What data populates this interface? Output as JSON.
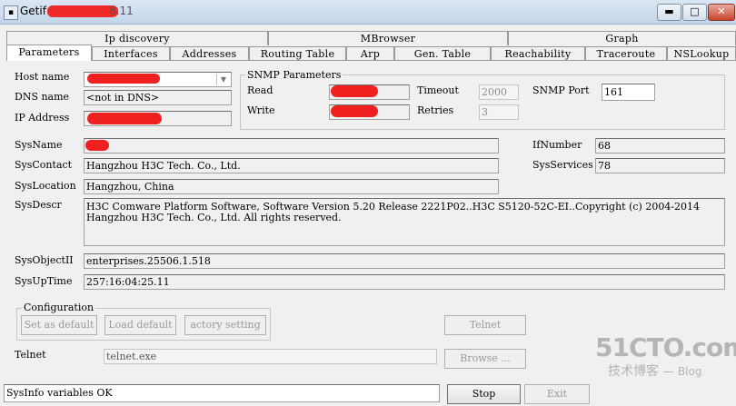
{
  "window": {
    "title": "Getif",
    "title_suffix": "8.11",
    "buttons": {
      "minimize": "▬",
      "maximize": "□",
      "close": "✕"
    }
  },
  "tabs_row1": [
    {
      "label": "Ip discovery"
    },
    {
      "label": "MBrowser"
    },
    {
      "label": "Graph"
    }
  ],
  "tabs_row2": [
    {
      "label": "Parameters"
    },
    {
      "label": "Interfaces"
    },
    {
      "label": "Addresses"
    },
    {
      "label": "Routing Table"
    },
    {
      "label": "Arp"
    },
    {
      "label": "Gen. Table"
    },
    {
      "label": "Reachability"
    },
    {
      "label": "Traceroute"
    },
    {
      "label": "NSLookup"
    }
  ],
  "host": {
    "host_name_label": "Host name",
    "dns_name_label": "DNS name",
    "dns_name_value": "<not in DNS>",
    "ip_address_label": "IP Address"
  },
  "snmp": {
    "group_label": "SNMP Parameters",
    "read_label": "Read",
    "write_label": "Write",
    "timeout_label": "Timeout",
    "timeout_value": "2000",
    "retries_label": "Retries",
    "retries_value": "3",
    "port_label": "SNMP Port",
    "port_value": "161"
  },
  "sysinfo": {
    "sysname_label": "SysName",
    "syscontact_label": "SysContact",
    "syscontact_value": "Hangzhou H3C Tech. Co., Ltd.",
    "syslocation_label": "SysLocation",
    "syslocation_value": "Hangzhou, China",
    "sysdescr_label": "SysDescr",
    "sysdescr_line1": "H3C Comware Platform Software, Software Version 5.20 Release 2221P02..H3C S5120-52C-EI..Copyright (c) 2004-2014",
    "sysdescr_line2": "Hangzhou H3C Tech. Co., Ltd. All rights reserved.",
    "sysobjectid_label": "SysObjectII",
    "sysobjectid_value": "enterprises.25506.1.518",
    "sysuptime_label": "SysUpTime",
    "sysuptime_value": "257:16:04:25.11",
    "ifnumber_label": "IfNumber",
    "ifnumber_value": "68",
    "sysservices_label": "SysServices",
    "sysservices_value": "78"
  },
  "configuration": {
    "group_label": "Configuration",
    "set_default": "Set as default",
    "load_default": "Load default",
    "factory_settings": "actory setting"
  },
  "telnet": {
    "label": "Telnet",
    "button": "Telnet",
    "path_value": "telnet.exe",
    "browse_button": "Browse ..."
  },
  "status": {
    "text": "SysInfo variables OK",
    "stop_button": "Stop",
    "exit_button": "Exit"
  },
  "watermark": {
    "site": "51CTO.com",
    "sub": "技术博客",
    "blog": "Blog"
  }
}
